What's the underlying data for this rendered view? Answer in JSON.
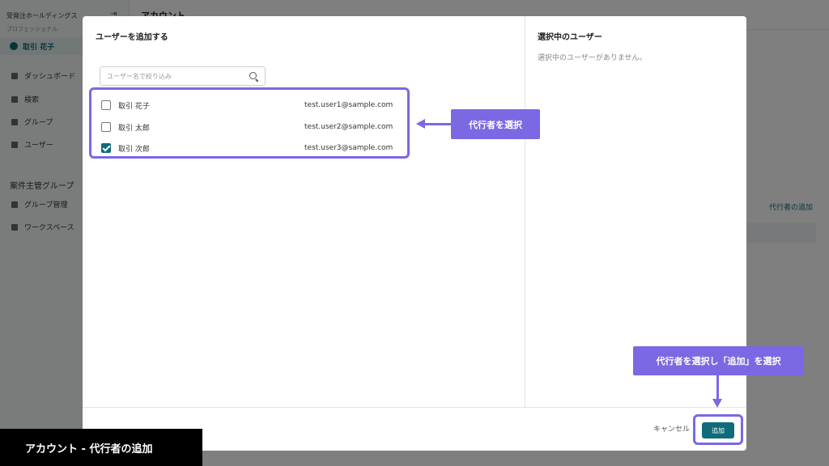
{
  "sidebar": {
    "org_name": "受発注ホールディングス",
    "plan": "プロフェッショナル",
    "current_user": "取引 花子",
    "items": [
      {
        "label": "ダッシュボード",
        "icon": "dashboard-icon"
      },
      {
        "label": "検索",
        "icon": "search-icon"
      },
      {
        "label": "グループ",
        "icon": "folder-icon"
      },
      {
        "label": "ユーザー",
        "icon": "users-icon"
      }
    ],
    "section_title": "案件主管グループ",
    "section_items": [
      {
        "label": "グループ管理",
        "icon": "group-manage-icon"
      },
      {
        "label": "ワークスペース",
        "icon": "list-icon"
      }
    ]
  },
  "main": {
    "title": "アカウント",
    "proxy_link": "代行者の追加"
  },
  "modal": {
    "left_title": "ユーザーを追加する",
    "search_placeholder": "ユーザー名で絞り込み",
    "users": [
      {
        "name": "取引 花子",
        "email": "test.user1@sample.com",
        "checked": false
      },
      {
        "name": "取引 太郎",
        "email": "test.user2@sample.com",
        "checked": false
      },
      {
        "name": "取引 次郎",
        "email": "test.user3@sample.com",
        "checked": true
      }
    ],
    "right_title": "選択中のユーザー",
    "empty_text": "選択中のユーザーがありません。",
    "cancel_label": "キャンセル",
    "add_label": "追加"
  },
  "annotations": {
    "select_proxy": "代行者を選択",
    "select_add": "代行者を選択し「追加」を選択"
  },
  "caption": "アカウント - 代行者の追加",
  "colors": {
    "accent": "#7b68e3",
    "primary": "#0f6b79",
    "caption_bg": "#000000"
  }
}
